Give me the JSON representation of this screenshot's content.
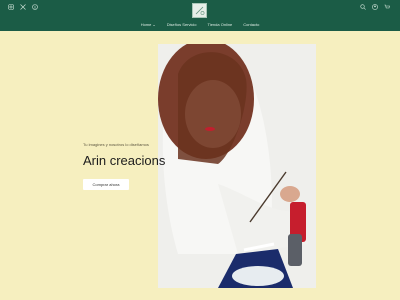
{
  "header": {
    "social_icons": [
      "instagram-icon",
      "x-icon",
      "pinterest-icon"
    ],
    "tool_icons": [
      "search-icon",
      "account-icon",
      "cart-icon"
    ],
    "logo_icon": "brand-logo-icon",
    "nav": [
      {
        "label": "Home",
        "has_dropdown": true
      },
      {
        "label": "Diseños Servicio"
      },
      {
        "label": "Tienda Online"
      },
      {
        "label": "Contacto"
      }
    ]
  },
  "hero": {
    "subtitle": "Tu imagines y nosotros lo diseñamos",
    "title": "Arin creacions",
    "button_label": "Comprar ahora",
    "image": "photo of a young woman painting lettering on a shoe"
  },
  "colors": {
    "header_bg": "#1b5c46",
    "page_bg": "#f6efbf",
    "button_bg": "#ffffff"
  }
}
